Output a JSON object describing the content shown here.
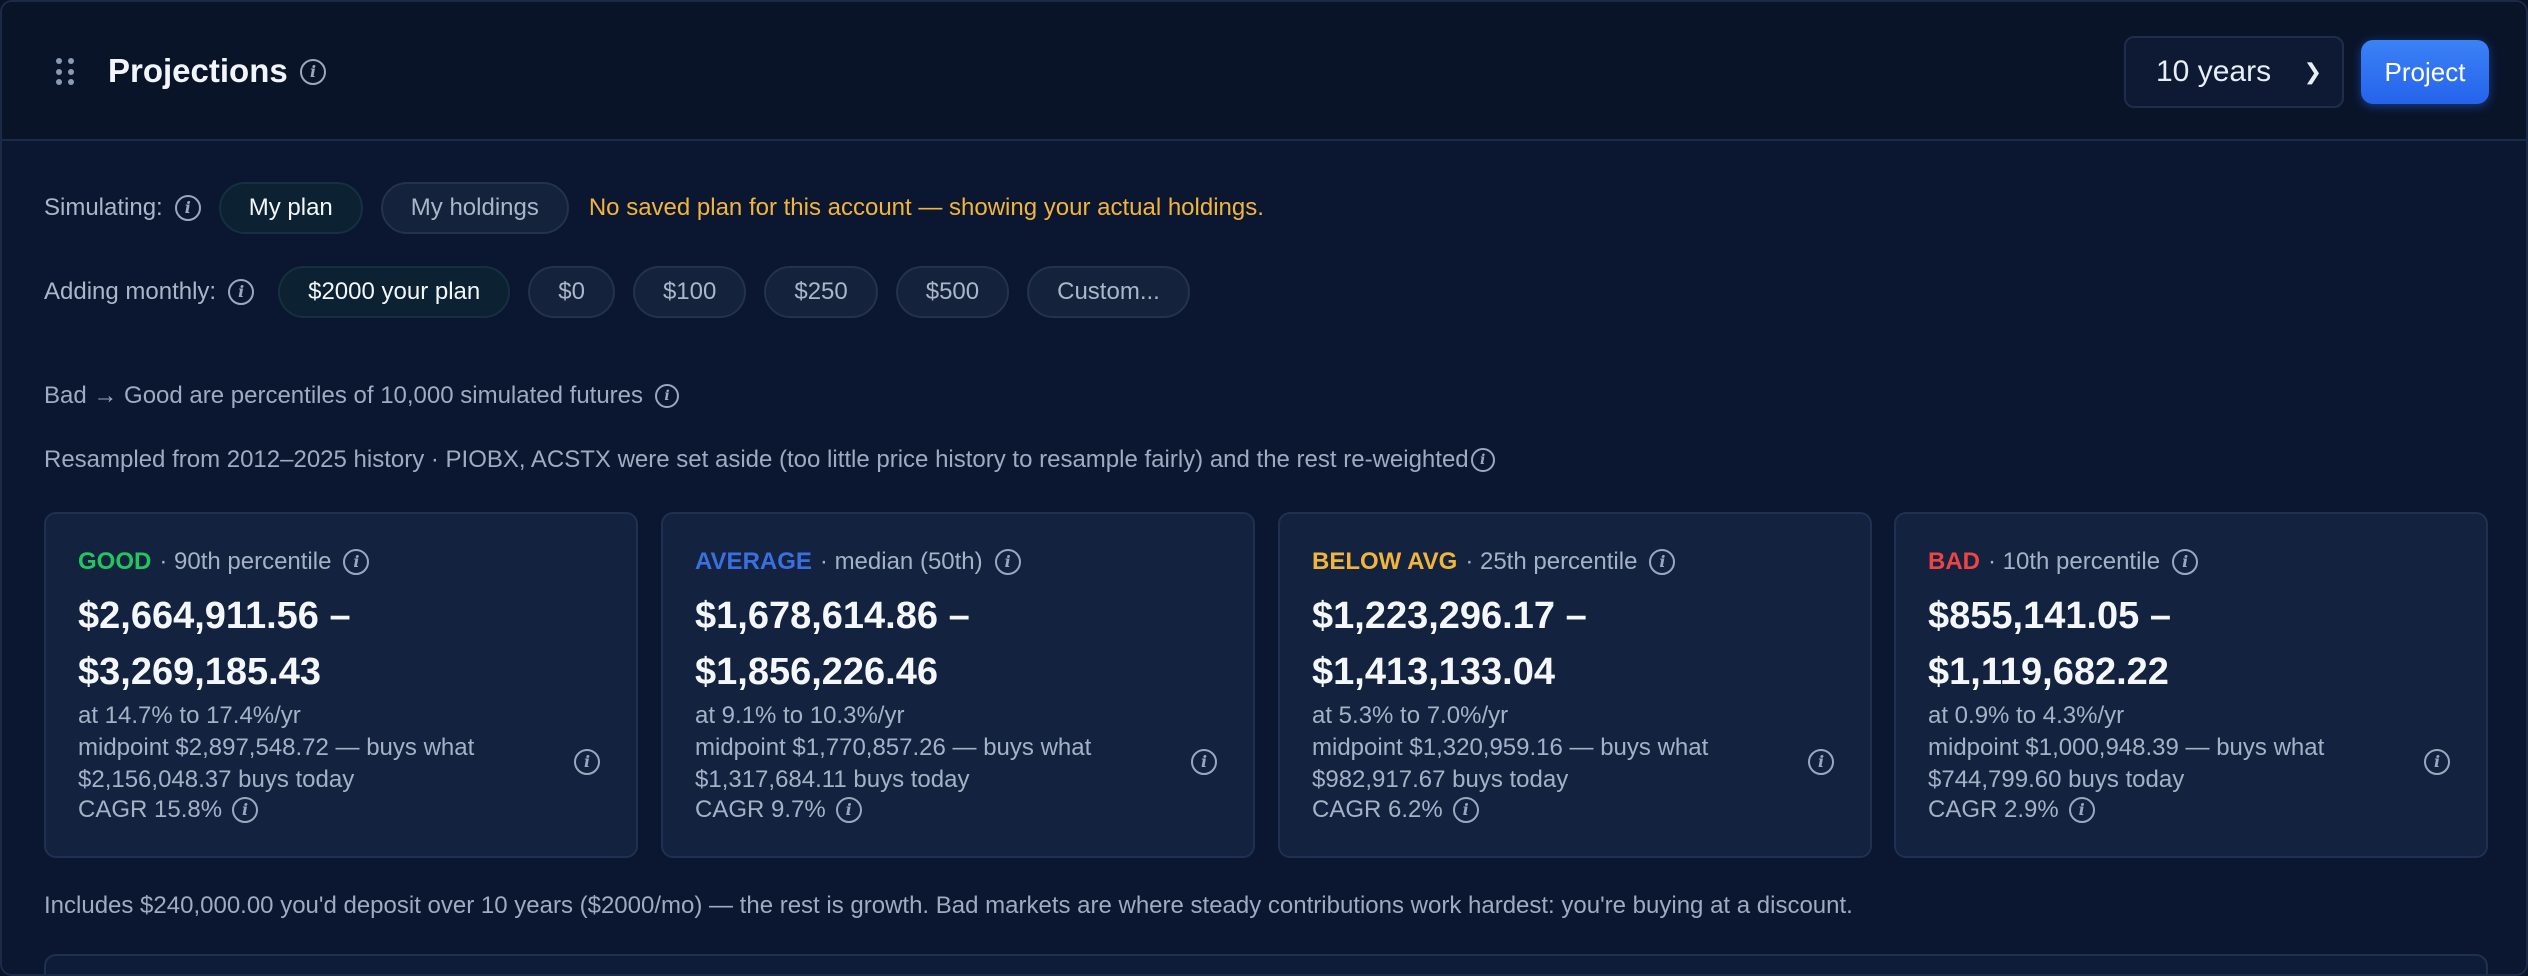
{
  "header": {
    "title": "Projections",
    "years_value": "10 years",
    "project_label": "Project"
  },
  "simulating": {
    "label": "Simulating:",
    "options": [
      "My plan",
      "My holdings"
    ],
    "notice": "No saved plan for this account — showing your actual holdings."
  },
  "monthly": {
    "label": "Adding monthly:",
    "options": [
      "$2000 your plan",
      "$0",
      "$100",
      "$250",
      "$500",
      "Custom..."
    ]
  },
  "notes": {
    "percentiles": "Bad → Good are percentiles of 10,000 simulated futures",
    "resampled": "Resampled from 2012–2025 history · PIOBX, ACSTX were set aside (too little price history to resample fairly) and the rest re-weighted"
  },
  "cards": [
    {
      "tier": "GOOD",
      "color": "#22c55e",
      "percentile": "· 90th percentile",
      "range_low": "$2,664,911.56 –",
      "range_high": "$3,269,185.43",
      "rate": "at 14.7% to 17.4%/yr",
      "midpoint": "midpoint $2,897,548.72 — buys what $2,156,048.37 buys today",
      "cagr": "CAGR 15.8%"
    },
    {
      "tier": "AVERAGE",
      "color": "#3b6fe0",
      "percentile": "· median (50th)",
      "range_low": "$1,678,614.86 –",
      "range_high": "$1,856,226.46",
      "rate": "at 9.1% to 10.3%/yr",
      "midpoint": "midpoint $1,770,857.26 — buys what $1,317,684.11 buys today",
      "cagr": "CAGR 9.7%"
    },
    {
      "tier": "BELOW AVG",
      "color": "#f2b53c",
      "percentile": "· 25th percentile",
      "range_low": "$1,223,296.17 –",
      "range_high": "$1,413,133.04",
      "rate": "at 5.3% to 7.0%/yr",
      "midpoint": "midpoint $1,320,959.16 — buys what $982,917.67 buys today",
      "cagr": "CAGR 6.2%"
    },
    {
      "tier": "BAD",
      "color": "#ef4444",
      "percentile": "· 10th percentile",
      "range_low": "$855,141.05 –",
      "range_high": "$1,119,682.22",
      "rate": "at 0.9% to 4.3%/yr",
      "midpoint": "midpoint $1,000,948.39 — buys what $744,799.60 buys today",
      "cagr": "CAGR 2.9%"
    }
  ],
  "footer_note": "Includes $240,000.00 you'd deposit over 10 years ($2000/mo) — the rest is growth. Bad markets are where steady contributions work hardest: you're buying at a discount."
}
